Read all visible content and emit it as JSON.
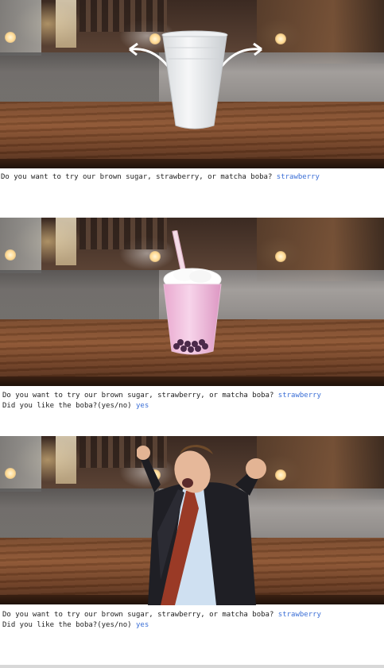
{
  "panels": [
    {
      "scene": "empty-cup",
      "lines": [
        {
          "prompt": "Do you want to try our brown sugar, strawberry, or matcha boba? ",
          "answer": "strawberry"
        }
      ]
    },
    {
      "scene": "strawberry-boba",
      "lines": [
        {
          "prompt": "Do you want to try our brown sugar, strawberry, or matcha boba? ",
          "answer": "strawberry"
        },
        {
          "prompt": "Did you like the boba?(yes/no) ",
          "answer": "yes"
        }
      ]
    },
    {
      "scene": "happy-person",
      "lines": [
        {
          "prompt": "Do you want to try our brown sugar, strawberry, or matcha boba? ",
          "answer": "strawberry"
        },
        {
          "prompt": "Did you like the boba?(yes/no) ",
          "answer": "yes"
        }
      ]
    }
  ],
  "colors": {
    "answer_text": "#3b6fd6",
    "prompt_text": "#222222"
  }
}
